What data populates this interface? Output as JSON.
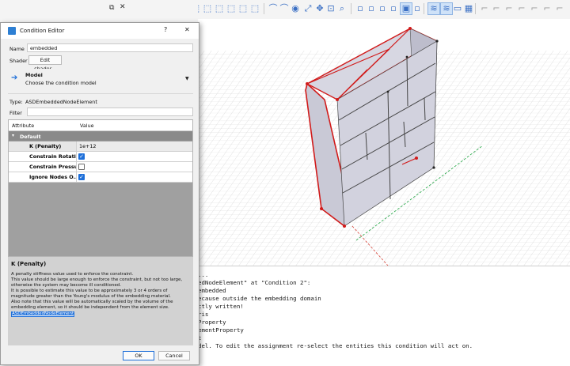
{
  "dialog": {
    "title": "Condition Editor",
    "help_button": "?",
    "close_button": "✕",
    "name_label": "Name",
    "name_value": "embedded",
    "shader_label": "Shader",
    "shader_button": "Edit shader...",
    "model_title": "Model",
    "model_subtitle": "Choose the condition model",
    "type_label": "Type:",
    "type_value": "ASDEmbeddedNodeElement",
    "filter_label": "Filter",
    "filter_value": "",
    "table": {
      "col_attribute": "Attribute",
      "col_value": "Value",
      "group": "Default",
      "rows": [
        {
          "name": "K (Penalty)",
          "value": "1e+12",
          "kind": "text"
        },
        {
          "name": "Constrain Rotati...",
          "checked": true,
          "kind": "check"
        },
        {
          "name": "Constrain Pressure",
          "checked": false,
          "kind": "check"
        },
        {
          "name": "Ignore Nodes O...",
          "checked": true,
          "kind": "check"
        }
      ]
    },
    "help": {
      "title": "K (Penalty)",
      "lines": [
        "A penalty stiffness value used to enforce the constraint.",
        "This value should be large enough to enforce the constraint, but not too large,",
        "otherwise the system may become ill conditioned.",
        "It is possible to estimate this value to be approximately 3 or 4 orders of",
        "magnitude greater than the Young's modulus of the embedding material.",
        "Also note that this value will be automatically scaled by the volume of the",
        "embedding element, so it should be independent from the element size."
      ],
      "link": "ASDEmbeddedNodeElement"
    },
    "ok_label": "OK",
    "cancel_label": "Cancel"
  },
  "panel": {
    "icons": [
      "panel-float-icon",
      "close-icon"
    ]
  },
  "console": {
    "lines": [
      "...",
      "edNodeElement\" at \"Condition 2\":",
      "embedded",
      "ecause outside the embedding domain",
      "ctly written!",
      "ris",
      "Property",
      "ementProperty",
      "t",
      "del. To edit the assignment re-select the entities this condition will act on."
    ]
  },
  "colors": {
    "accent": "#1e6fd9",
    "selection_red": "#d11a1a",
    "model_fill": "#cdcdd9",
    "help_bg": "#d2d2d2"
  }
}
